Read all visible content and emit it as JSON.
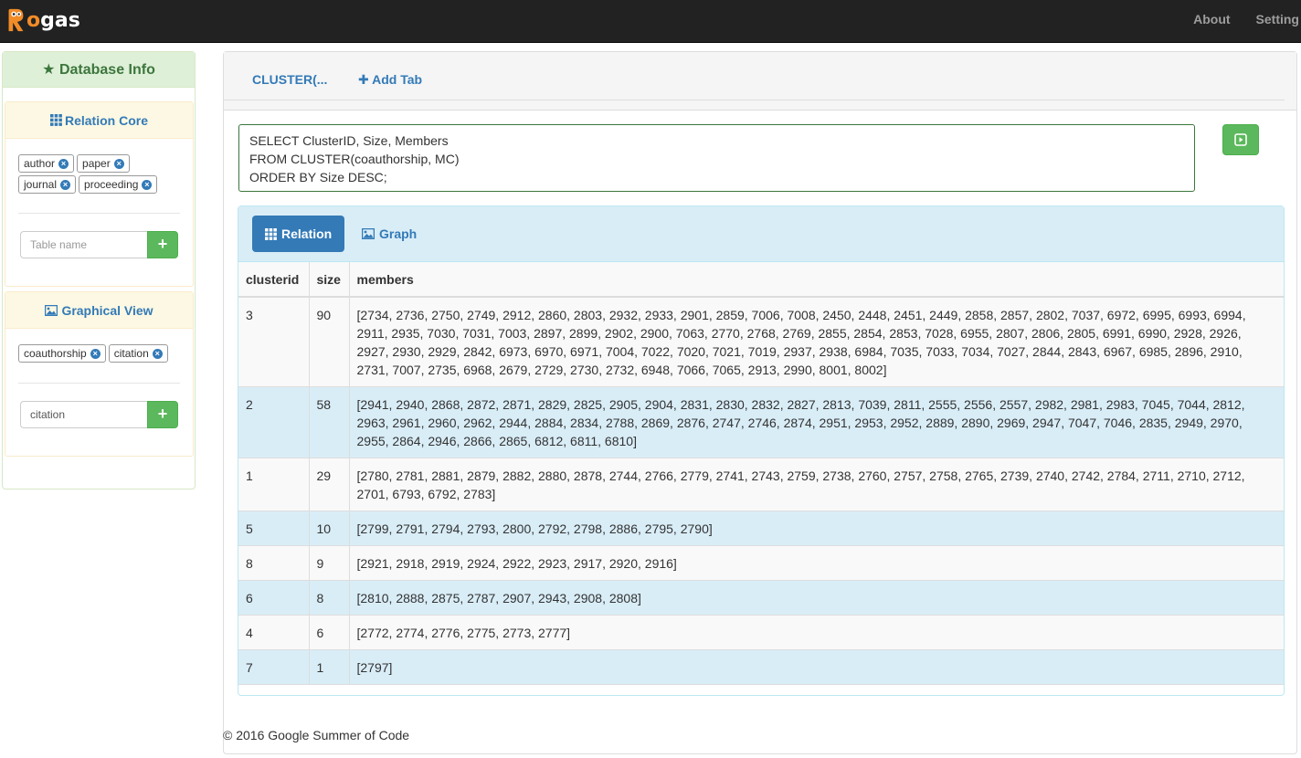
{
  "app": {
    "logo_text_r": "R",
    "logo_text_rest": "gas",
    "logo_o": "o"
  },
  "nav": {
    "about": "About",
    "setting": "Setting"
  },
  "sidebar": {
    "title": "Database Info",
    "relation_core": {
      "heading": "Relation Core",
      "tags": [
        "author",
        "paper",
        "journal",
        "proceeding"
      ],
      "input_placeholder": "Table name"
    },
    "graphical_view": {
      "heading": "Graphical View",
      "tags": [
        "coauthorship",
        "citation"
      ],
      "input_value": "citation"
    }
  },
  "tabs": {
    "current": "CLUSTER(...",
    "add": "Add Tab"
  },
  "query": {
    "lines": [
      "SELECT ClusterID, Size, Members",
      "FROM CLUSTER(coauthorship, MC)",
      "ORDER BY Size DESC;"
    ]
  },
  "result": {
    "tab_relation": "Relation",
    "tab_graph": "Graph",
    "columns": [
      "clusterid",
      "size",
      "members"
    ],
    "rows": [
      {
        "clusterid": "3",
        "size": "90",
        "members": "[2734, 2736, 2750, 2749, 2912, 2860, 2803, 2932, 2933, 2901, 2859, 7006, 7008, 2450, 2448, 2451, 2449, 2858, 2857, 2802, 7037, 6972, 6995, 6993, 6994, 2911, 2935, 7030, 7031, 7003, 2897, 2899, 2902, 2900, 7063, 2770, 2768, 2769, 2855, 2854, 2853, 7028, 6955, 2807, 2806, 2805, 6991, 6990, 2928, 2926, 2927, 2930, 2929, 2842, 6973, 6970, 6971, 7004, 7022, 7020, 7021, 7019, 2937, 2938, 6984, 7035, 7033, 7034, 7027, 2844, 2843, 6967, 6985, 2896, 2910, 2731, 7007, 2735, 6968, 2679, 2729, 2730, 2732, 6948, 7066, 7065, 2913, 2990, 8001, 8002]"
      },
      {
        "clusterid": "2",
        "size": "58",
        "members": "[2941, 2940, 2868, 2872, 2871, 2829, 2825, 2905, 2904, 2831, 2830, 2832, 2827, 2813, 7039, 2811, 2555, 2556, 2557, 2982, 2981, 2983, 7045, 7044, 2812, 2963, 2961, 2960, 2962, 2944, 2884, 2834, 2788, 2869, 2876, 2747, 2746, 2874, 2951, 2953, 2952, 2889, 2890, 2969, 2947, 7047, 7046, 2835, 2949, 2970, 2955, 2864, 2946, 2866, 2865, 6812, 6811, 6810]"
      },
      {
        "clusterid": "1",
        "size": "29",
        "members": "[2780, 2781, 2881, 2879, 2882, 2880, 2878, 2744, 2766, 2779, 2741, 2743, 2759, 2738, 2760, 2757, 2758, 2765, 2739, 2740, 2742, 2784, 2711, 2710, 2712, 2701, 6793, 6792, 2783]"
      },
      {
        "clusterid": "5",
        "size": "10",
        "members": "[2799, 2791, 2794, 2793, 2800, 2792, 2798, 2886, 2795, 2790]"
      },
      {
        "clusterid": "8",
        "size": "9",
        "members": "[2921, 2918, 2919, 2924, 2922, 2923, 2917, 2920, 2916]"
      },
      {
        "clusterid": "6",
        "size": "8",
        "members": "[2810, 2888, 2875, 2787, 2907, 2943, 2908, 2808]"
      },
      {
        "clusterid": "4",
        "size": "6",
        "members": "[2772, 2774, 2776, 2775, 2773, 2777]"
      },
      {
        "clusterid": "7",
        "size": "1",
        "members": "[2797]"
      }
    ]
  },
  "footer": "© 2016 Google Summer of Code",
  "colors": {
    "navbar": "#222222",
    "primary": "#337ab7",
    "success": "#5cb85c",
    "info_bg": "#d9edf7",
    "warning_bg": "#fcf8e3",
    "success_bg": "#dff0d8"
  }
}
